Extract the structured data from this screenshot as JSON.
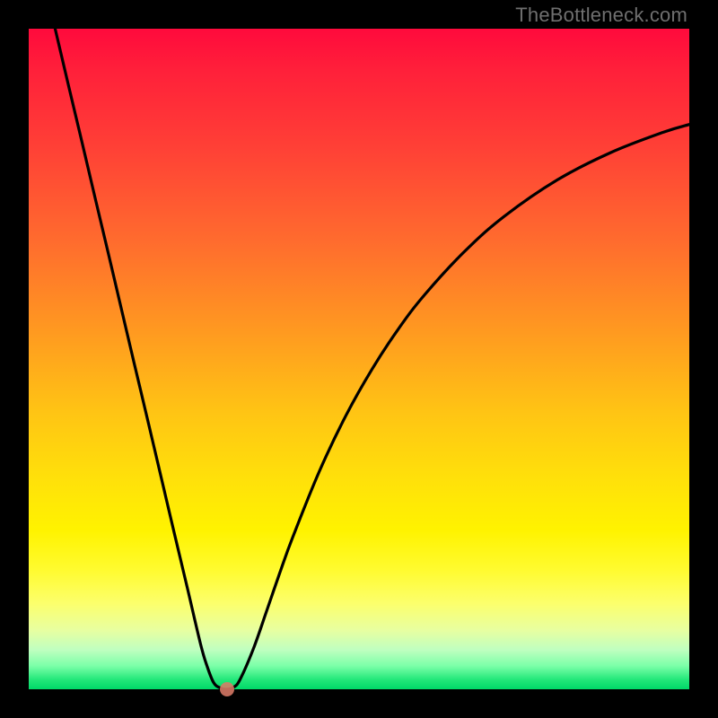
{
  "attribution": "TheBottleneck.com",
  "colors": {
    "page_bg": "#000000",
    "text": "#6f6f6f",
    "marker": "#d97a66",
    "gradient_top": "#ff0a3c",
    "gradient_bottom": "#00d968"
  },
  "chart_data": {
    "type": "line",
    "title": "",
    "xlabel": "",
    "ylabel": "",
    "xlim": [
      0,
      100
    ],
    "ylim": [
      0,
      100
    ],
    "grid": false,
    "legend": false,
    "series": [
      {
        "name": "bottleneck_curve",
        "x": [
          4,
          6,
          8,
          10,
          12,
          14,
          16,
          18,
          20,
          22,
          24,
          26,
          27,
          28,
          29,
          30,
          31,
          32,
          34,
          36,
          38,
          40,
          44,
          48,
          52,
          56,
          60,
          66,
          72,
          80,
          88,
          96,
          100
        ],
        "y": [
          100,
          91.5,
          83.1,
          74.6,
          66.2,
          57.7,
          49.2,
          40.8,
          32.3,
          23.8,
          15.4,
          6.9,
          3.5,
          1.0,
          0.2,
          0.0,
          0.3,
          1.5,
          6.1,
          11.8,
          17.6,
          23.1,
          33.0,
          41.4,
          48.5,
          54.6,
          59.8,
          66.3,
          71.6,
          77.1,
          81.2,
          84.3,
          85.5
        ]
      }
    ],
    "annotations": [
      {
        "name": "marker",
        "x": 30,
        "y": 0
      }
    ]
  }
}
